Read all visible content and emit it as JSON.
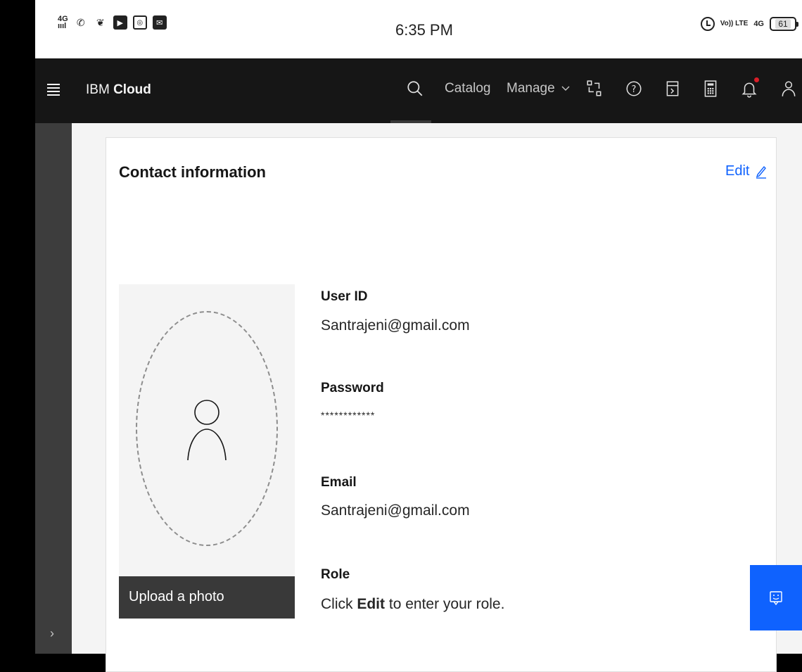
{
  "status_bar": {
    "signal": "4G",
    "time": "6:35 PM",
    "network": "4G",
    "volte": "Vo)) LTE",
    "battery": "61"
  },
  "header": {
    "brand_prefix": "IBM",
    "brand_name": "Cloud",
    "nav": {
      "catalog": "Catalog",
      "manage": "Manage"
    }
  },
  "card": {
    "title": "Contact information",
    "edit_label": "Edit",
    "upload_label": "Upload a photo",
    "fields": {
      "user_id": {
        "label": "User ID",
        "value": "Santrajeni@gmail.com"
      },
      "password": {
        "label": "Password",
        "value": "************"
      },
      "email": {
        "label": "Email",
        "value": "Santrajeni@gmail.com"
      },
      "role": {
        "label": "Role",
        "value_prefix": "Click",
        "value_bold": "Edit",
        "value_suffix": "to enter your role."
      }
    }
  },
  "colors": {
    "header_bg": "#161616",
    "accent": "#0f62fe",
    "notification": "#da1e28"
  }
}
